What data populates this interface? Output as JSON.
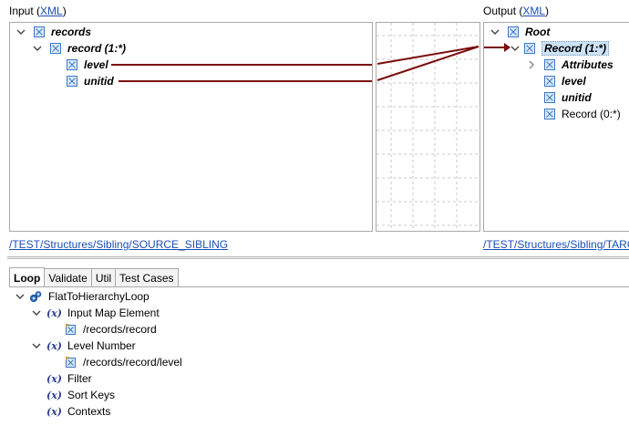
{
  "input": {
    "label": "Input (",
    "link": "XML",
    "label_end": ")",
    "path": "/TEST/Structures/Sibling/SOURCE_SIBLING",
    "tree": {
      "root": "records",
      "record": "record (1:*)",
      "level": "level",
      "unitid": "unitid"
    }
  },
  "output": {
    "label": "Output (",
    "link": "XML",
    "label_end": ")",
    "path": "/TEST/Structures/Sibling/TARG",
    "tree": {
      "root": "Root",
      "record": "Record (1:*)",
      "attributes": "Attributes",
      "level": "level",
      "unitid": "unitid",
      "record_child": "Record (0:*)"
    }
  },
  "tabs": [
    "Loop",
    "Validate",
    "Util",
    "Test Cases"
  ],
  "loop_tree": {
    "name": "FlatToHierarchyLoop",
    "input_map_element": "Input Map Element",
    "input_map_value": "/records/record",
    "level_number": "Level Number",
    "level_number_value": "/records/record/level",
    "filter": "Filter",
    "sort_keys": "Sort Keys",
    "contexts": "Contexts",
    "var_symbol": "(x)"
  },
  "colors": {
    "mapping_line": "#7b0d0d",
    "link": "#1a4fb5",
    "selection": "#cde4f7"
  }
}
